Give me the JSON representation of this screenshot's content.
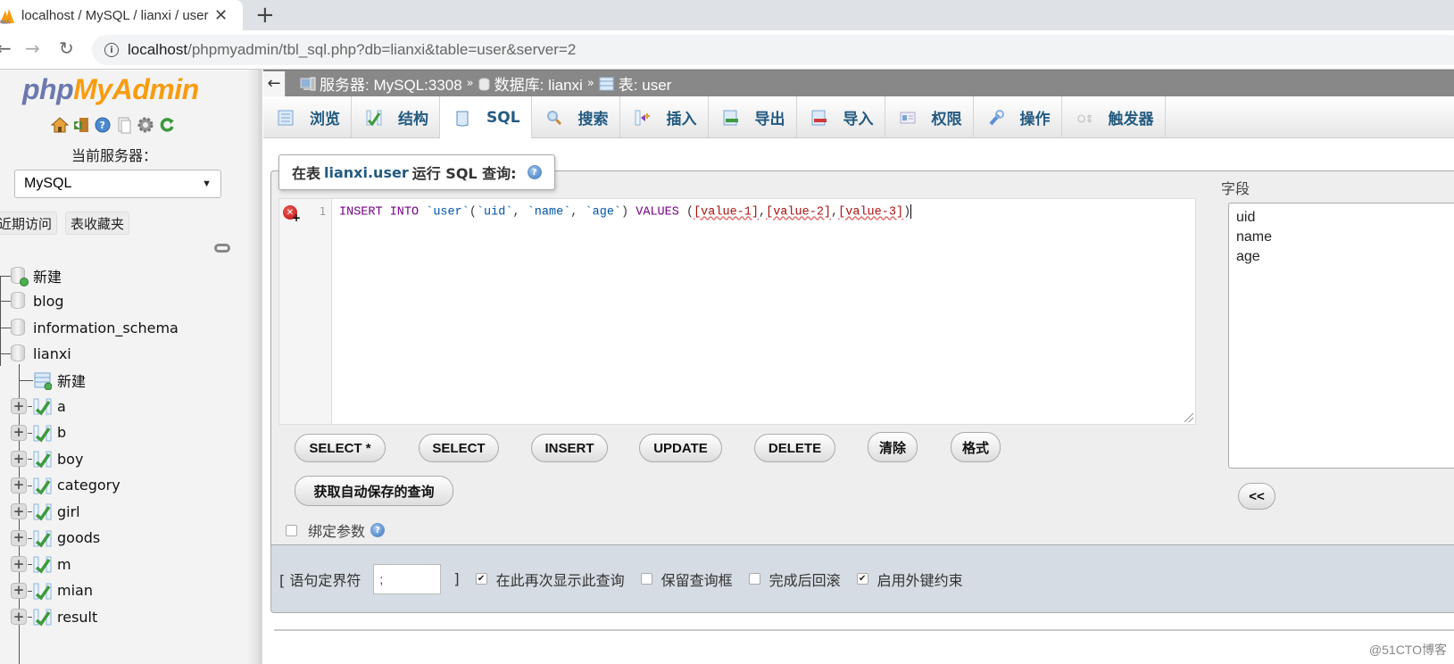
{
  "browser": {
    "tab_title": "localhost / MySQL / lianxi / user | phpMyAdmin",
    "tab_close": "✕",
    "new_tab": "+",
    "url_host": "localhost",
    "url_path": "/phpmyadmin/tbl_sql.php?db=lianxi&table=user&server=2",
    "nav": {
      "back": "←",
      "forward": "→",
      "reload": "↻"
    }
  },
  "sidebar": {
    "logo_php": "php",
    "logo_myadmin": "MyAdmin",
    "icons": [
      "home-icon",
      "logout-icon",
      "help-icon",
      "docs-icon",
      "settings-icon",
      "reload-icon"
    ],
    "server_label": "当前服务器：",
    "server_select": "MySQL",
    "tabs": {
      "recent": "近期访问",
      "favorites": "表收藏夹"
    },
    "tree": {
      "new_db": "新建",
      "databases": [
        "blog",
        "information_schema",
        "lianxi"
      ],
      "lianxi_new_table": "新建",
      "tables": [
        "a",
        "b",
        "boy",
        "category",
        "girl",
        "goods",
        "m",
        "mian",
        "result"
      ]
    }
  },
  "breadcrumb": {
    "collapse": "←",
    "server": "服务器: MySQL:3308",
    "database": "数据库: lianxi",
    "table": "表: user",
    "separator": "»"
  },
  "tabs": [
    {
      "label": "浏览",
      "icon": "browse-icon",
      "active": false
    },
    {
      "label": "结构",
      "icon": "structure-icon",
      "active": false
    },
    {
      "label": "SQL",
      "icon": "sql-icon",
      "active": true
    },
    {
      "label": "搜索",
      "icon": "search-icon",
      "active": false
    },
    {
      "label": "插入",
      "icon": "insert-icon",
      "active": false
    },
    {
      "label": "导出",
      "icon": "export-icon",
      "active": false
    },
    {
      "label": "导入",
      "icon": "import-icon",
      "active": false
    },
    {
      "label": "权限",
      "icon": "privileges-icon",
      "active": false
    },
    {
      "label": "操作",
      "icon": "operations-icon",
      "active": false
    },
    {
      "label": "触发器",
      "icon": "triggers-icon",
      "active": false
    }
  ],
  "query": {
    "legend_prefix": "在表",
    "legend_table": "lianxi.user",
    "legend_suffix": "运行 SQL 查询:",
    "help": "?",
    "line_number": "1",
    "code": {
      "kw1": "INSERT INTO",
      "tbl": "`user`",
      "open": "(",
      "c1": "`uid`",
      "comma": ",",
      "c2": "`name`",
      "c3": "`age`",
      "close": ")",
      "kw2": "VALUES",
      "v_open": "(",
      "v1": "[value-1]",
      "v2": "[value-2]",
      "v3": "[value-3]",
      "v_close": ")"
    },
    "buttons": [
      "SELECT *",
      "SELECT",
      "INSERT",
      "UPDATE",
      "DELETE",
      "清除",
      "格式"
    ],
    "autosave_button": "获取自动保存的查询",
    "bind_params": "绑定参数",
    "bind_params_checked": false
  },
  "fields": {
    "label": "字段",
    "items": [
      "uid",
      "name",
      "age"
    ],
    "insert_button": "<<"
  },
  "options": {
    "delimiter_label_open": "[ 语句定界符",
    "delimiter_value": ";",
    "delimiter_label_close": "]",
    "checkboxes": [
      {
        "label": "在此再次显示此查询",
        "checked": true
      },
      {
        "label": "保留查询框",
        "checked": false
      },
      {
        "label": "完成后回滚",
        "checked": false
      },
      {
        "label": "启用外键约束",
        "checked": true
      }
    ]
  },
  "watermark": "@51CTO博客"
}
